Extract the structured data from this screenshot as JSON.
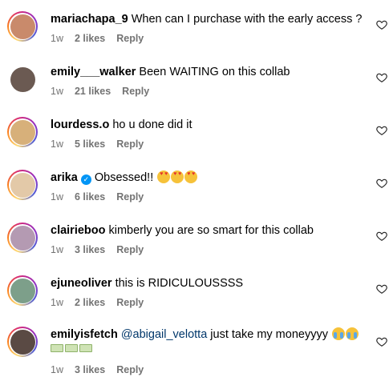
{
  "comments": [
    {
      "username": "mariachapa_9",
      "text": "When can I purchase with the early access ?",
      "time": "1w",
      "likes": "2 likes",
      "reply": "Reply",
      "avatar_color": "#c98a6b",
      "story_ring": true
    },
    {
      "username": "emily___walker",
      "text": "Been WAITING on this collab",
      "time": "1w",
      "likes": "21 likes",
      "reply": "Reply",
      "avatar_color": "#6b5a52",
      "story_ring": false
    },
    {
      "username": "lourdess.o",
      "text": "ho u done did it",
      "time": "1w",
      "likes": "5 likes",
      "reply": "Reply",
      "avatar_color": "#d7b07a",
      "story_ring": true
    },
    {
      "username": "arika",
      "text": "Obsessed!!",
      "time": "1w",
      "likes": "6 likes",
      "reply": "Reply",
      "avatar_color": "#e3c9a8",
      "story_ring": true,
      "verified": true,
      "emoji": [
        "heart-eyes-emoji",
        "heart-eyes-emoji",
        "heart-eyes-emoji"
      ]
    },
    {
      "username": "clairieboo",
      "text": "kimberly you are so smart for this collab",
      "time": "1w",
      "likes": "3 likes",
      "reply": "Reply",
      "avatar_color": "#b49ab2",
      "story_ring": true
    },
    {
      "username": "ejuneoliver",
      "text": "this is RIDICULOUSSSS",
      "time": "1w",
      "likes": "2 likes",
      "reply": "Reply",
      "avatar_color": "#7d9f8a",
      "story_ring": true
    },
    {
      "username": "emilyisfetch",
      "mention": "@abigail_velotta",
      "text": "just take my moneyyyy",
      "time": "1w",
      "likes": "3 likes",
      "reply": "Reply",
      "avatar_color": "#5a4a44",
      "story_ring": true,
      "emoji": [
        "crying-emoji",
        "crying-emoji"
      ],
      "second_line_emoji": [
        "money-emoji",
        "money-emoji",
        "money-emoji"
      ]
    }
  ],
  "icons": {
    "like": "heart-outline-icon"
  },
  "colors": {
    "meta_text": "#737373",
    "mention": "#00376b",
    "verified": "#0095f6"
  }
}
